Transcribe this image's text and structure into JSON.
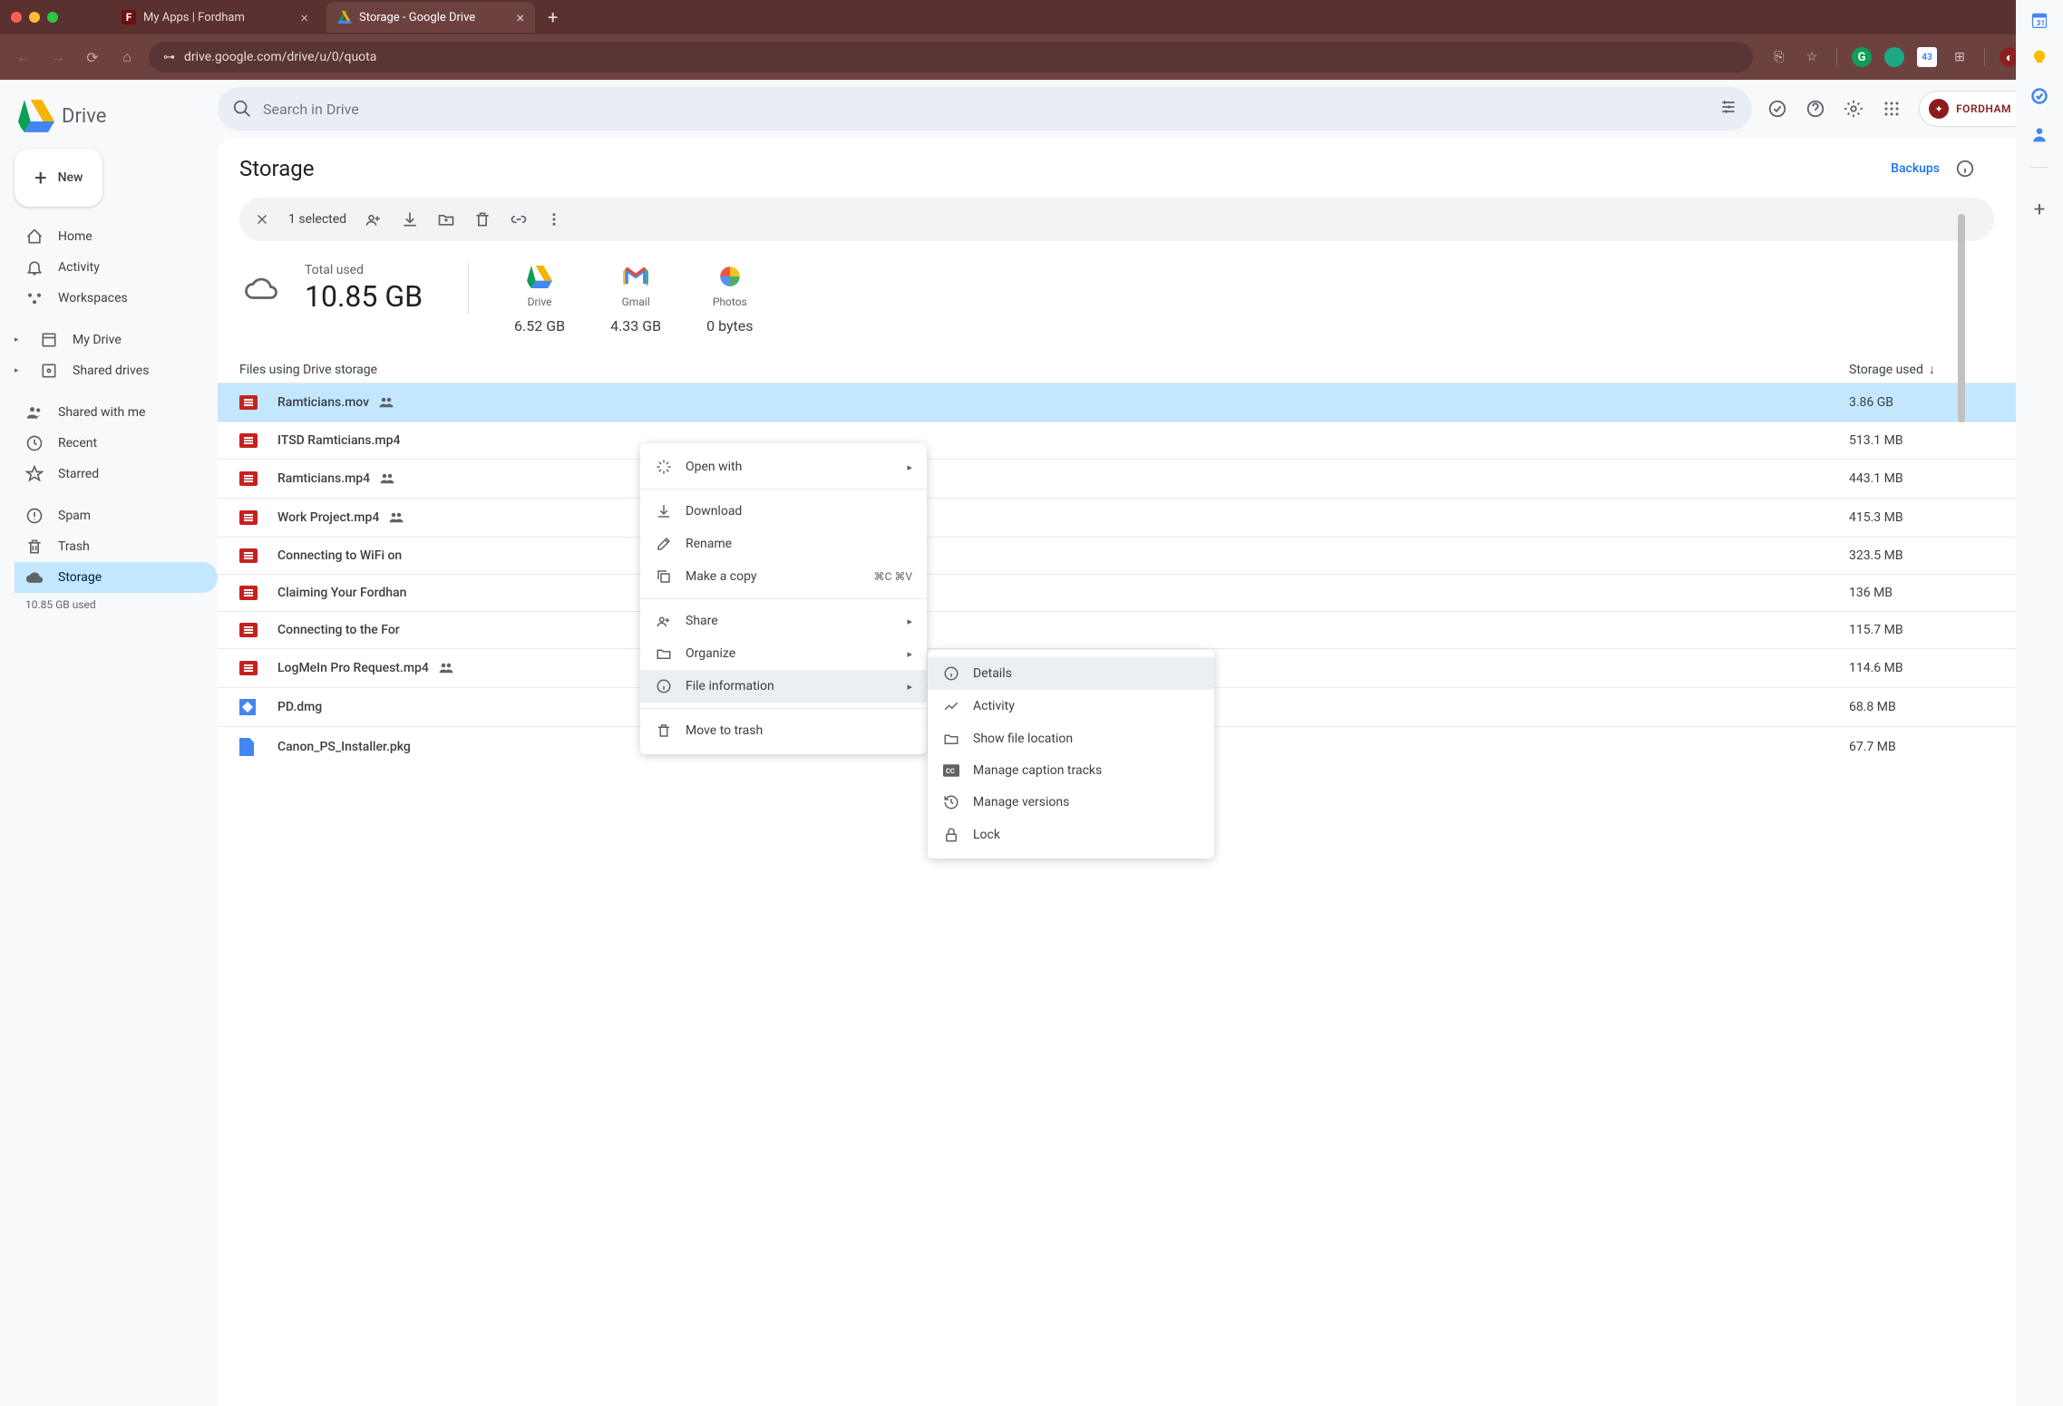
{
  "chrome": {
    "tabs": [
      {
        "title": "My Apps | Fordham",
        "favicon": "F",
        "active": false
      },
      {
        "title": "Storage - Google Drive",
        "favicon": "△",
        "active": true
      }
    ],
    "url": "drive.google.com/drive/u/0/quota",
    "extension_badge": "43"
  },
  "drive": {
    "logo_text": "Drive",
    "new_button": "New",
    "search_placeholder": "Search in Drive",
    "nav_primary": [
      {
        "icon": "home",
        "label": "Home"
      },
      {
        "icon": "bell",
        "label": "Activity"
      },
      {
        "icon": "workspaces",
        "label": "Workspaces"
      }
    ],
    "nav_drives": [
      {
        "icon": "mydrive",
        "label": "My Drive",
        "expandable": true
      },
      {
        "icon": "shareddrives",
        "label": "Shared drives",
        "expandable": true
      }
    ],
    "nav_secondary": [
      {
        "icon": "shared",
        "label": "Shared with me"
      },
      {
        "icon": "recent",
        "label": "Recent"
      },
      {
        "icon": "star",
        "label": "Starred"
      }
    ],
    "nav_tertiary": [
      {
        "icon": "spam",
        "label": "Spam"
      },
      {
        "icon": "trash",
        "label": "Trash"
      },
      {
        "icon": "storage",
        "label": "Storage",
        "active": true
      }
    ],
    "storage_used_text": "10.85 GB used",
    "page_title": "Storage",
    "backups_label": "Backups",
    "selection_text": "1 selected",
    "total_used_label": "Total used",
    "total_used_value": "10.85 GB",
    "categories": [
      {
        "name": "Drive",
        "size": "6.52 GB"
      },
      {
        "name": "Gmail",
        "size": "4.33 GB"
      },
      {
        "name": "Photos",
        "size": "0 bytes"
      }
    ],
    "list_header_name": "Files using Drive storage",
    "list_header_size": "Storage used",
    "files": [
      {
        "name": "Ramticians.mov",
        "size": "3.86 GB",
        "type": "video",
        "shared": true,
        "selected": true
      },
      {
        "name": "ITSD Ramticians.mp4",
        "size": "513.1 MB",
        "type": "video",
        "shared": false
      },
      {
        "name": "Ramticians.mp4",
        "size": "443.1 MB",
        "type": "video",
        "shared": true
      },
      {
        "name": "Work Project.mp4",
        "size": "415.3 MB",
        "type": "video",
        "shared": true
      },
      {
        "name": "Connecting to WiFi on",
        "size": "323.5 MB",
        "type": "video",
        "shared": false
      },
      {
        "name": "Claiming Your Fordhan",
        "size": "136 MB",
        "type": "video",
        "shared": false
      },
      {
        "name": "Connecting to the For",
        "size": "115.7 MB",
        "type": "video",
        "shared": false
      },
      {
        "name": "LogMeIn Pro Request.mp4",
        "size": "114.6 MB",
        "type": "video",
        "shared": true
      },
      {
        "name": "PD.dmg",
        "size": "68.8 MB",
        "type": "dmg",
        "shared": false
      },
      {
        "name": "Canon_PS_Installer.pkg",
        "size": "67.7 MB",
        "type": "pkg",
        "shared": false
      }
    ],
    "context_menu": {
      "open_with": "Open with",
      "download": "Download",
      "rename": "Rename",
      "make_copy": "Make a copy",
      "make_copy_shortcut": "⌘C ⌘V",
      "share": "Share",
      "organize": "Organize",
      "file_info": "File information",
      "move_trash": "Move to trash"
    },
    "submenu": {
      "details": "Details",
      "activity": "Activity",
      "show_location": "Show file location",
      "captions": "Manage caption tracks",
      "versions": "Manage versions",
      "lock": "Lock"
    },
    "org_name": "FORDHAM"
  }
}
